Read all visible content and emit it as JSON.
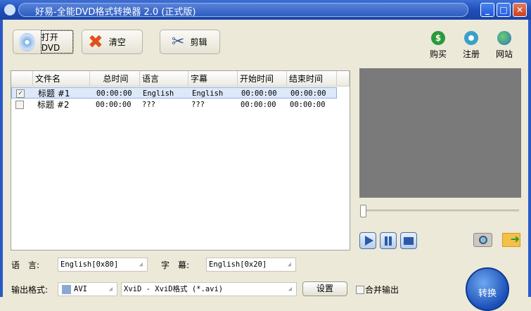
{
  "window": {
    "title": "好易-全能DVD格式转换器 2.0  (正式版)",
    "minimize": "_",
    "maximize": "□",
    "close": "✕"
  },
  "toolbar": {
    "open": "打开DVD",
    "clear": "清空",
    "edit": "剪辑"
  },
  "links": {
    "buy": "购买",
    "register": "注册",
    "website": "网站",
    "buy_icon": "$"
  },
  "table": {
    "columns": [
      "文件名",
      "总时间",
      "语言",
      "字幕",
      "开始时间",
      "结束时间"
    ],
    "rows": [
      {
        "checked": true,
        "name": "标题 #1",
        "total": "00:00:00",
        "lang": "English",
        "sub": "English",
        "start": "00:00:00",
        "end": "00:00:00"
      },
      {
        "checked": false,
        "name": "标题 #2",
        "total": "00:00:00",
        "lang": "???",
        "sub": "???",
        "start": "00:00:00",
        "end": "00:00:00"
      }
    ]
  },
  "player": {
    "progress": 0
  },
  "options": {
    "language_label": "语　言:",
    "language_value": "English[0x80]",
    "subtitle_label": "字　幕:",
    "subtitle_value": "English[0x20]",
    "format_label": "输出格式:",
    "format_value": "AVI",
    "codec_value": "XviD - XviD格式 (*.avi)",
    "settings": "设置",
    "merge_label": "合并输出",
    "merge_checked": false,
    "convert": "转换"
  }
}
